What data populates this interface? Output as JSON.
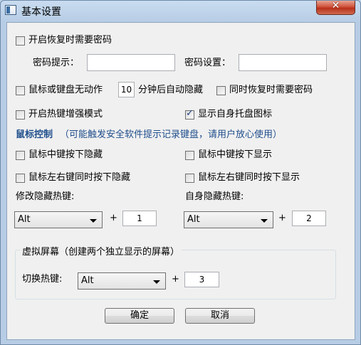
{
  "window": {
    "title": "基本设置",
    "close_glyph": "✕"
  },
  "options": {
    "restore_password": {
      "label": "开启恢复时需要密码",
      "checked": false
    },
    "password_hint_label": "密码提示：",
    "password_hint_value": "",
    "password_set_label": "密码设置：",
    "password_set_value": "",
    "idle_hide": {
      "label_before": "鼠标或键盘无动作",
      "minutes": "10",
      "label_after": "分钟后自动隐藏",
      "checked": false
    },
    "restore_need_password": {
      "label": "同时恢复时需要密码",
      "checked": false
    },
    "hotkey_enhance": {
      "label": "开启热键增强模式",
      "checked": false
    },
    "show_tray_icon": {
      "label": "显示自身托盘图标",
      "checked": true
    }
  },
  "mouse_control": {
    "title": "鼠标控制",
    "note": "（可能触发安全软件提示记录键盘，请用户放心使用）",
    "middle_hide": {
      "label": "鼠标中键按下隐藏",
      "checked": false
    },
    "middle_show": {
      "label": "鼠标中键按下显示",
      "checked": false
    },
    "lr_hide": {
      "label": "鼠标左右键同时按下隐藏",
      "checked": false
    },
    "lr_show": {
      "label": "鼠标左右键同时按下显示",
      "checked": false
    }
  },
  "hotkeys": {
    "modify_label": "修改隐藏热键:",
    "modify_modifier": "Alt",
    "modify_key": "1",
    "self_label": "自身隐藏热键:",
    "self_modifier": "Alt",
    "self_key": "2",
    "plus": "+"
  },
  "virtual_screen": {
    "title": "虚拟屏幕（创建两个独立显示的屏幕）",
    "switch_label": "切换热键:",
    "modifier": "Alt",
    "key": "3"
  },
  "buttons": {
    "ok": "确定",
    "cancel": "取消"
  }
}
